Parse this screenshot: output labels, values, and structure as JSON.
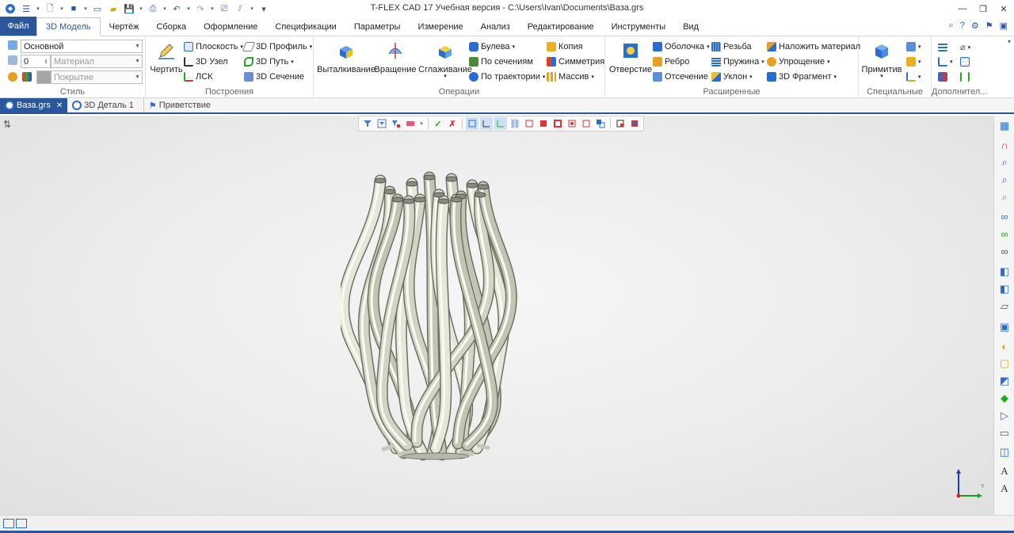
{
  "window": {
    "title": "T-FLEX CAD 17 Учебная версия - C:\\Users\\Ivan\\Documents\\Ваза.grs"
  },
  "tabs": {
    "file": "Файл",
    "items": [
      "3D Модель",
      "Чертёж",
      "Сборка",
      "Оформление",
      "Спецификации",
      "Параметры",
      "Измерение",
      "Анализ",
      "Редактирование",
      "Инструменты",
      "Вид"
    ],
    "active_index": 0
  },
  "ribbon": {
    "style": {
      "label": "Стиль",
      "layer": "Основной",
      "number": "0",
      "material_placeholder": "Материал",
      "coating_placeholder": "Покрытие"
    },
    "construct": {
      "label": "Построения",
      "draw": "Чертить",
      "plane": "Плоскость",
      "node3d": "3D Узел",
      "lsk": "ЛСК",
      "profile3d": "3D Профиль",
      "path3d": "3D Путь",
      "section3d": "3D Сечение"
    },
    "operations": {
      "label": "Операции",
      "extrude": "Выталкивание",
      "rotate": "Вращение",
      "smooth": "Сглаживание",
      "boolean": "Булева",
      "by_sections": "По сечениям",
      "by_trajectory": "По траектории",
      "copy": "Копия",
      "symmetry": "Симметрия",
      "array": "Массив"
    },
    "extended": {
      "label": "Расширенные",
      "hole": "Отверстие",
      "shell": "Оболочка",
      "rib": "Ребро",
      "cut": "Отсечение",
      "thread": "Резьба",
      "spring": "Пружина",
      "slope": "Уклон",
      "apply_material": "Наложить материал",
      "simplify": "Упрощение",
      "fragment3d": "3D Фрагмент"
    },
    "special": {
      "label": "Специальные",
      "primitive": "Примитив"
    },
    "additional": {
      "label": "Дополнител..."
    }
  },
  "doc_tabs": [
    {
      "label": "Ваза.grs",
      "active": true
    },
    {
      "label": "3D Деталь 1",
      "active": false
    },
    {
      "label": "Приветствие",
      "active": false
    }
  ],
  "icons": {
    "accent": "#2b579a",
    "model_color": "#d8d8cc"
  },
  "axes": {
    "y": "Y"
  }
}
